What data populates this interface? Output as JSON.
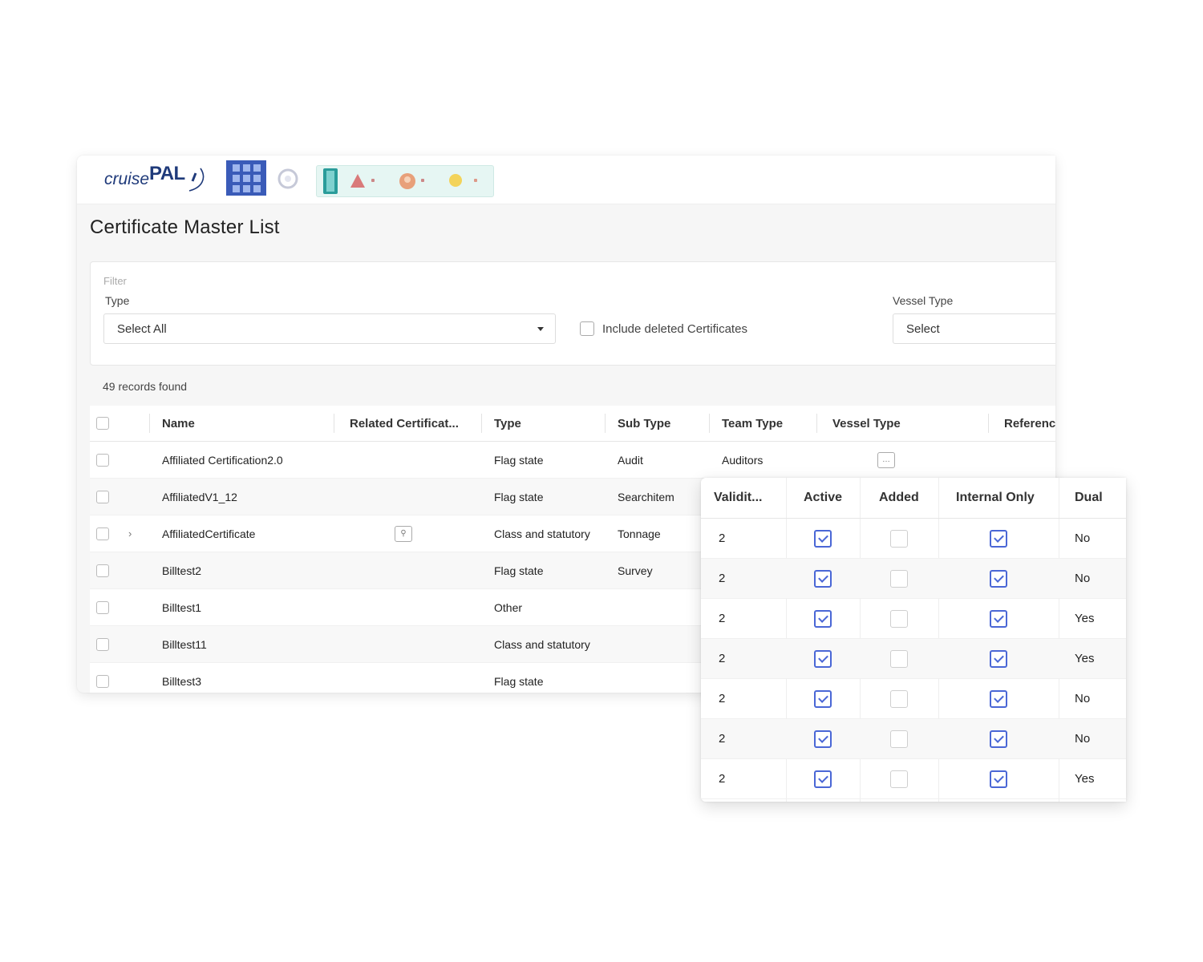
{
  "brand": {
    "logo_text": "cruise",
    "logo_strong": "PAL"
  },
  "page": {
    "title": "Certificate Master List"
  },
  "filter": {
    "section_label": "Filter",
    "type_label": "Type",
    "type_value": "Select All",
    "include_deleted_label": "Include deleted Certificates",
    "vessel_type_label": "Vessel Type",
    "vessel_type_value": "Select"
  },
  "records_found": "49 records found",
  "grid": {
    "columns": [
      "Name",
      "Related Certificat...",
      "Type",
      "Sub Type",
      "Team Type",
      "Vessel Type",
      "Referenc"
    ],
    "rows": [
      {
        "name": "Affiliated Certification2.0",
        "type": "Flag state",
        "sub_type": "Audit",
        "team_type": "Auditors"
      },
      {
        "name": "AffiliatedV1_12",
        "type": "Flag state",
        "sub_type": "Searchitem",
        "team_type": ""
      },
      {
        "name": "AffiliatedCertificate",
        "type": "Class and statutory",
        "sub_type": "Tonnage",
        "team_type": ""
      },
      {
        "name": "Billtest2",
        "type": "Flag state",
        "sub_type": "Survey",
        "team_type": ""
      },
      {
        "name": "Billtest1",
        "type": "Other",
        "sub_type": "",
        "team_type": ""
      },
      {
        "name": "Billtest11",
        "type": "Class and statutory",
        "sub_type": "",
        "team_type": ""
      },
      {
        "name": "Billtest3",
        "type": "Flag state",
        "sub_type": "",
        "team_type": ""
      }
    ]
  },
  "overlay": {
    "columns": [
      "Validit...",
      "Active",
      "Added",
      "Internal Only",
      "Dual"
    ],
    "rows": [
      {
        "validity": "2",
        "dual": "No"
      },
      {
        "validity": "2",
        "dual": "No"
      },
      {
        "validity": "2",
        "dual": "Yes"
      },
      {
        "validity": "2",
        "dual": "Yes"
      },
      {
        "validity": "2",
        "dual": "No"
      },
      {
        "validity": "2",
        "dual": "No"
      },
      {
        "validity": "2",
        "dual": "Yes"
      }
    ]
  },
  "colors": {
    "accent": "#4a67d6",
    "brand": "#1f3a7a",
    "apps_button": "#3a5bb8"
  },
  "icons": [
    "apps-grid-icon",
    "settings-icon",
    "door-icon",
    "alert-icon",
    "user-avatar-icon",
    "lightbulb-icon",
    "certificate-link-icon"
  ]
}
